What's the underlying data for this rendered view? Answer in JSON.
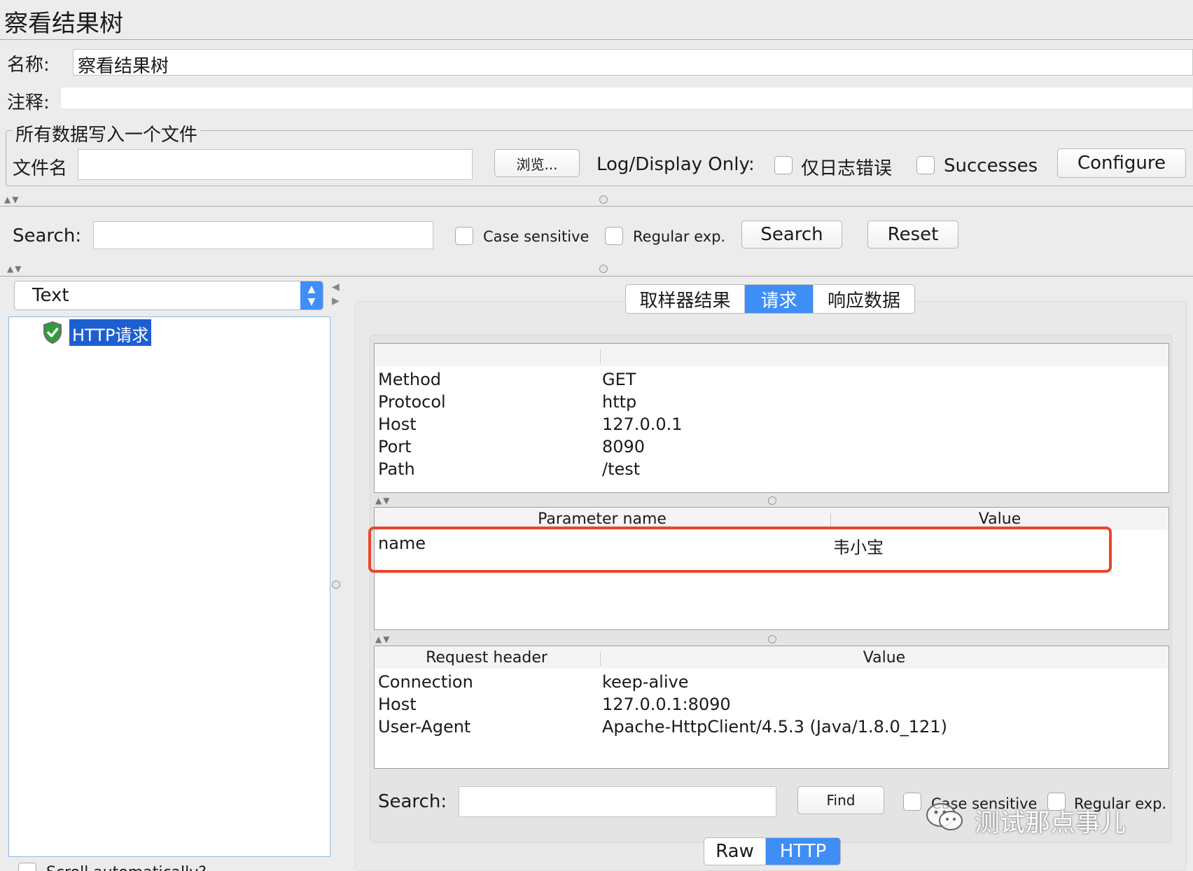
{
  "window": {
    "title": "察看结果树"
  },
  "form": {
    "name_label": "名称:",
    "name_value": "察看结果树",
    "comment_label": "注释:",
    "comment_value": ""
  },
  "file_group": {
    "legend": "所有数据写入一个文件",
    "filename_label": "文件名",
    "filename_value": "",
    "browse_label": "浏览...",
    "log_display_label": "Log/Display Only:",
    "errors_label": "仅日志错误",
    "successes_label": "Successes",
    "configure_label": "Configure"
  },
  "search_bar": {
    "label": "Search:",
    "value": "",
    "case_sensitive_label": "Case sensitive",
    "regex_label": "Regular exp.",
    "search_button": "Search",
    "reset_button": "Reset"
  },
  "renderer": {
    "selected": "Text"
  },
  "tree": {
    "items": [
      {
        "label": "HTTP请求",
        "status": "success"
      }
    ],
    "scroll_label": "Scroll automatically?"
  },
  "tabs": [
    {
      "label": "取样器结果",
      "active": false
    },
    {
      "label": "请求",
      "active": true
    },
    {
      "label": "响应数据",
      "active": false
    }
  ],
  "request_info": {
    "rows": [
      {
        "key": "Method",
        "value": "GET"
      },
      {
        "key": "Protocol",
        "value": "http"
      },
      {
        "key": "Host",
        "value": "127.0.0.1"
      },
      {
        "key": "Port",
        "value": "8090"
      },
      {
        "key": "Path",
        "value": "/test"
      }
    ]
  },
  "params": {
    "header_name": "Parameter name",
    "header_value": "Value",
    "rows": [
      {
        "name": "name",
        "value": "韦小宝"
      }
    ],
    "highlight_color": "#e8472a"
  },
  "headers": {
    "header_name": "Request header",
    "header_value": "Value",
    "rows": [
      {
        "key": "Connection",
        "value": "keep-alive"
      },
      {
        "key": "Host",
        "value": "127.0.0.1:8090"
      },
      {
        "key": "User-Agent",
        "value": "Apache-HttpClient/4.5.3 (Java/1.8.0_121)"
      }
    ]
  },
  "bottom_search": {
    "label": "Search:",
    "value": "",
    "find_button": "Find",
    "case_sensitive_label": "Case sensitive",
    "regex_label": "Regular exp."
  },
  "view_tabs": [
    {
      "label": "Raw",
      "active": false
    },
    {
      "label": "HTTP",
      "active": true
    }
  ],
  "watermark": {
    "text": "测试那点事儿"
  },
  "colors": {
    "accent": "#3e8ef6",
    "selection": "#1d5fd0",
    "highlight": "#e8472a"
  }
}
